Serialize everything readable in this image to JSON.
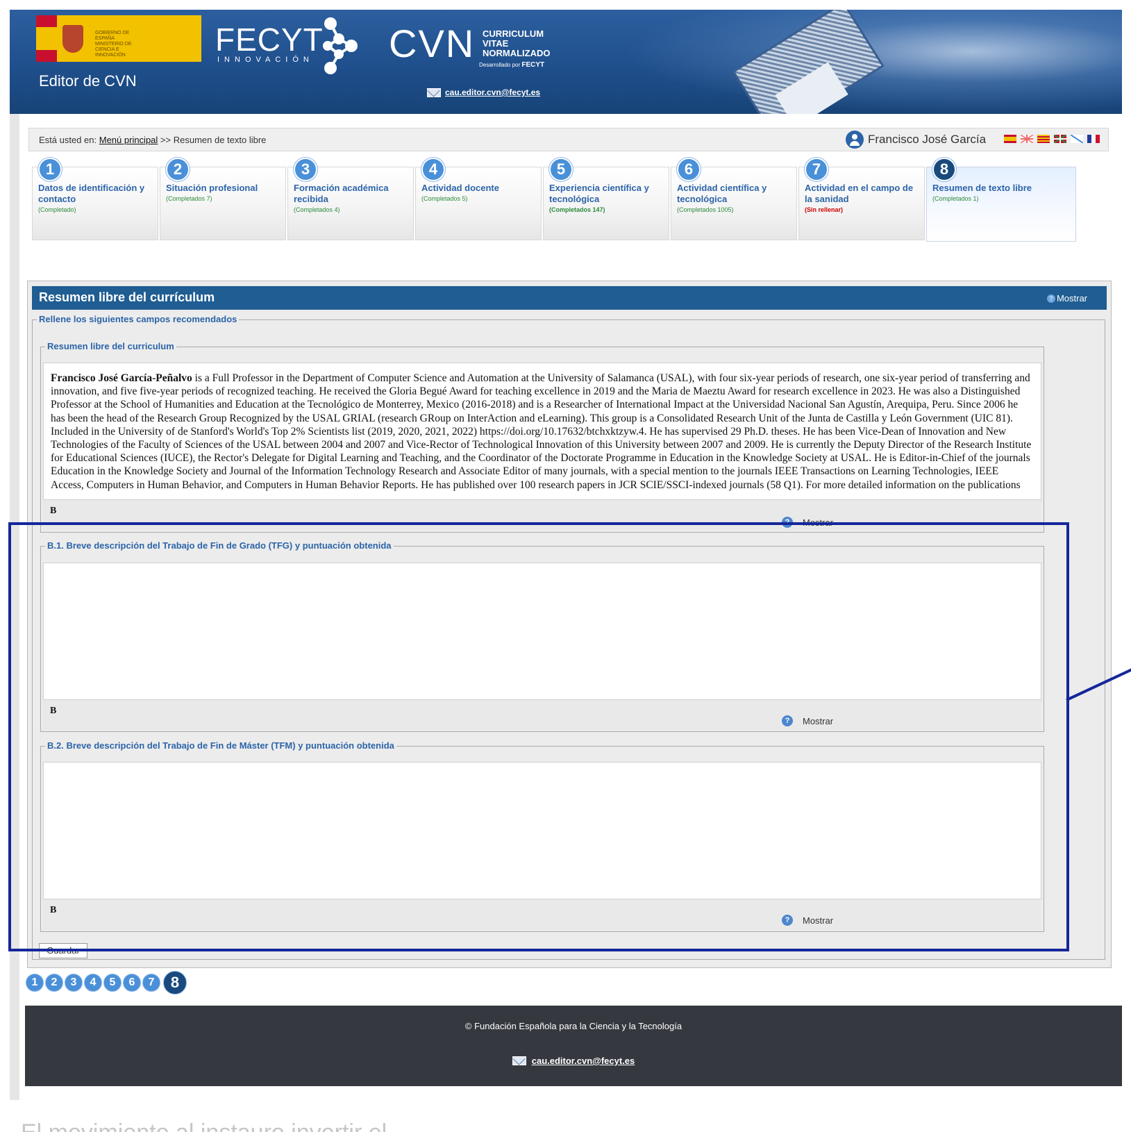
{
  "header": {
    "gov_text": "GOBIERNO DE ESPAÑA  MINISTERIO DE CIENCIA E INNOVACIÓN",
    "editor_title": "Editor de CVN",
    "fecyt": "FECYT",
    "fecyt_sub": "INNOVACIÓN",
    "cvn": "CVN",
    "cvn_sub": "CURRICULUM VITAE NORMALIZADO",
    "cvn_by_prefix": "Desarrollado por",
    "cvn_by_brand": "FECYT",
    "email": "cau.editor.cvn@fecyt.es"
  },
  "breadcrumb": {
    "prefix": "Está usted en:",
    "link": "Menú principal",
    "sep": ">>",
    "current": "Resumen de texto libre"
  },
  "user": {
    "name": "Francisco José García"
  },
  "language_flags": [
    "es-flag-icon",
    "uk-flag-icon",
    "ca-flag-icon",
    "eu-flag-icon",
    "gl-flag-icon",
    "fr-flag-icon"
  ],
  "tabs": [
    {
      "num": "1",
      "title": "Datos de identificación y contacto",
      "status": "(Completado)"
    },
    {
      "num": "2",
      "title": "Situación profesional",
      "status": "(Completados 7)"
    },
    {
      "num": "3",
      "title": "Formación académica recibida",
      "status": "(Completados 4)"
    },
    {
      "num": "4",
      "title": "Actividad docente",
      "status": "(Completados 5)"
    },
    {
      "num": "5",
      "title": "Experiencia científica y tecnológica",
      "status": "(Completados 147)"
    },
    {
      "num": "6",
      "title": "Actividad científica y tecnológica",
      "status": "(Completados 1005)"
    },
    {
      "num": "7",
      "title": "Actividad en el campo de la sanidad",
      "status": "(Sin rellenar)"
    },
    {
      "num": "8",
      "title": "Resumen de texto libre",
      "status": "(Completados 1)"
    }
  ],
  "form": {
    "title": "Resumen libre del currículum",
    "help_label": "Mostrar",
    "group_legend": "Rellene los siguientes campos recomendados",
    "summary": {
      "legend": "Resumen libre del curriculum",
      "author": "Francisco José García-Peñalvo",
      "text": " is a Full Professor in the Department of Computer Science and Automation at the University of Salamanca (USAL), with four six-year periods of research, one six-year period of transferring and innovation, and five five-year periods of recognized teaching. He received the Gloria Begué Award for teaching excellence in 2019 and the Maria de Maeztu Award for research excellence in 2023. He was also a Distinguished Professor at the School of Humanities and Education at the Tecnológico de Monterrey, Mexico (2016-2018) and is a Researcher of International Impact at the Universidad Nacional San Agustín, Arequipa, Peru. Since 2006 he has been the head of the Research Group Recognized by the USAL GRIAL (research GRoup on InterAction and eLearning). This group is a Consolidated Research Unit of the Junta de Castilla y León Government (UIC 81). Included in the University of de Stanford's World's Top 2% Scientists list (2019, 2020, 2021, 2022) https://doi.org/10.17632/btchxktzyw.4. He has supervised 29 Ph.D. theses. He has been Vice-Dean of Innovation and New Technologies of the Faculty of Sciences of the USAL between 2004 and 2007 and Vice-Rector of Technological Innovation of this University between 2007 and 2009. He is currently the Deputy Director of the Research Institute for Educational Sciences (IUCE), the Rector's Delegate for Digital Learning and Teaching, and the Coordinator of the Doctorate Programme in Education in the Knowledge Society at USAL. He is Editor-in-Chief of the journals Education in the Knowledge Society and Journal of the Information Technology Research and Associate Editor of many journals, with a special mention to the journals IEEE Transactions on Learning Technologies, IEEE Access, Computers in Human Behavior, and Computers in Human Behavior Reports. He has published over 100 research papers in JCR SCIE/SSCI-indexed journals (58 Q1). For more detailed information on the publications"
    },
    "b1": {
      "legend": "B.1. Breve descripción del Trabajo de Fin de Grado (TFG) y puntuación obtenida",
      "text": ""
    },
    "b2": {
      "legend": "B.2. Breve descripción del Trabajo de Fin de Máster (TFM) y puntuación obtenida",
      "text": ""
    },
    "bold_label": "B",
    "mostrar_label": "Mostrar",
    "save_label": "Guardar"
  },
  "page_numbers": [
    "1",
    "2",
    "3",
    "4",
    "5",
    "6",
    "7",
    "8"
  ],
  "footer": {
    "copyright": "© Fundación Española para la Ciencia y la Tecnología",
    "email": "cau.editor.cvn@fecyt.es"
  },
  "caption": "El movimiento al instauro invertir el"
}
